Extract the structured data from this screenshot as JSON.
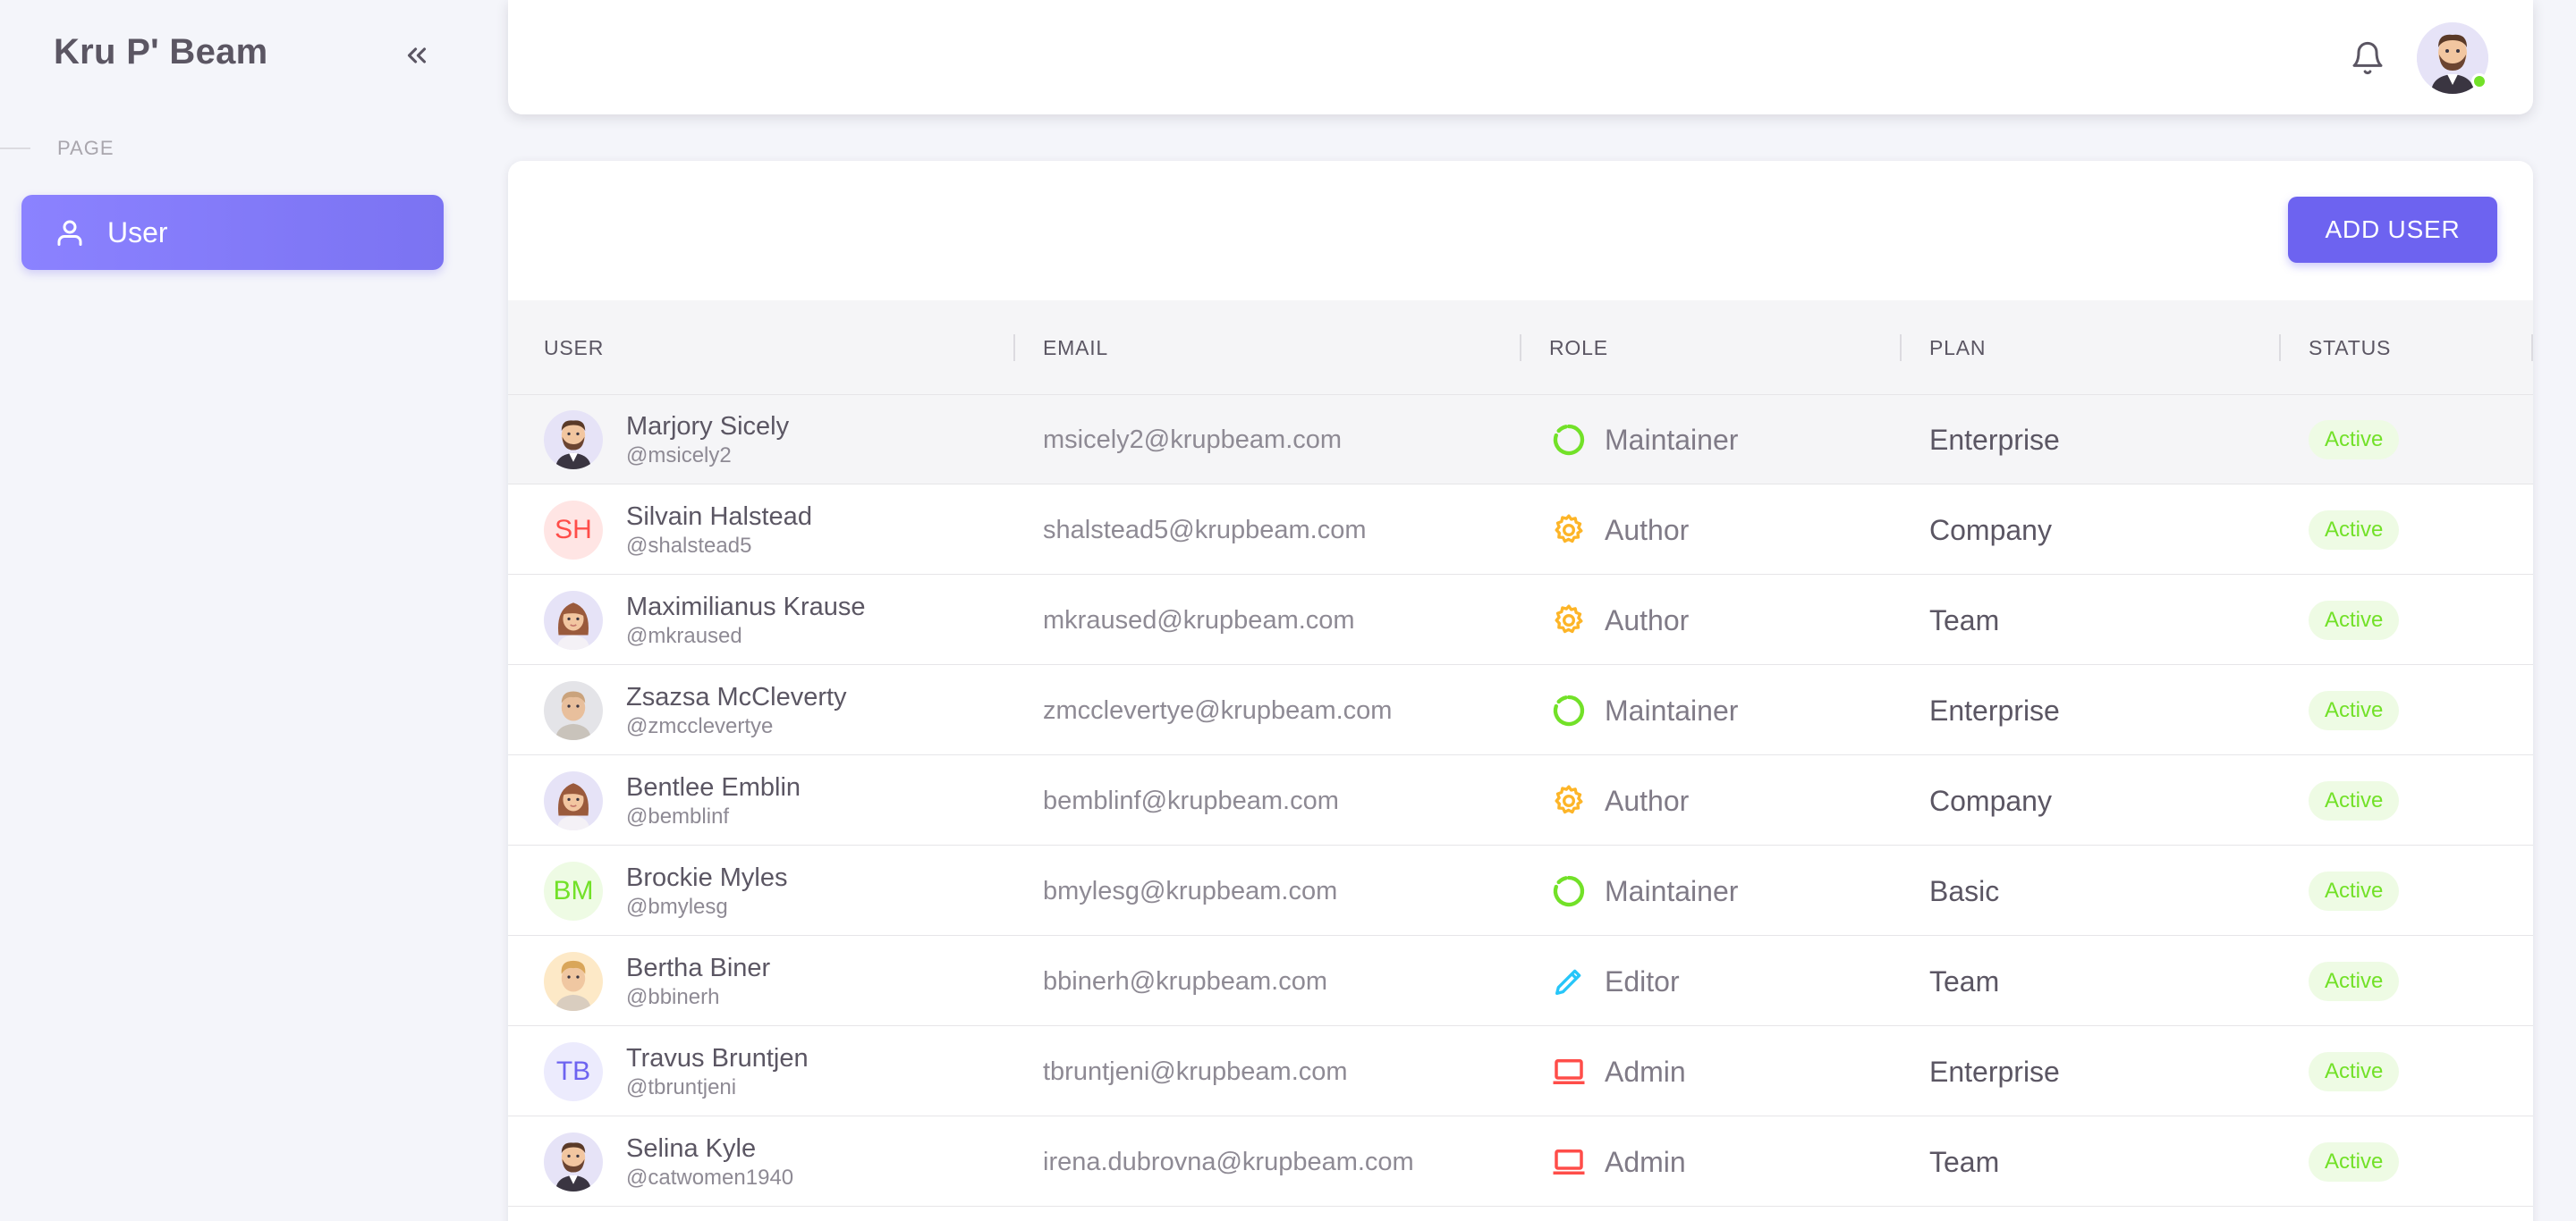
{
  "sidebar": {
    "brand": "Kru P' Beam",
    "collapse_icon": "chevron-double-left-icon",
    "section_label": "PAGE",
    "items": [
      {
        "label": "User",
        "icon": "person-icon",
        "active": true
      }
    ]
  },
  "header": {
    "notification_icon": "bell-icon",
    "avatar_icon": "user-avatar",
    "status": "online"
  },
  "main": {
    "add_button": "ADD USER",
    "columns": [
      "USER",
      "EMAIL",
      "ROLE",
      "PLAN",
      "STATUS"
    ],
    "rows": [
      {
        "name": "Marjory Sicely",
        "handle": "@msicely2",
        "avatar": "man-beard",
        "email": "msicely2@krupbeam.com",
        "role": "Maintainer",
        "role_icon": "maintainer-icon",
        "plan": "Enterprise",
        "status": "Active"
      },
      {
        "name": "Silvain Halstead",
        "handle": "@shalstead5",
        "avatar": "SH",
        "email": "shalstead5@krupbeam.com",
        "role": "Author",
        "role_icon": "cog-icon",
        "plan": "Company",
        "status": "Active"
      },
      {
        "name": "Maximilianus Krause",
        "handle": "@mkraused",
        "avatar": "woman",
        "email": "mkraused@krupbeam.com",
        "role": "Author",
        "role_icon": "cog-icon",
        "plan": "Team",
        "status": "Active"
      },
      {
        "name": "Zsazsa McCleverty",
        "handle": "@zmcclevertye",
        "avatar": "man-grey",
        "email": "zmcclevertye@krupbeam.com",
        "role": "Maintainer",
        "role_icon": "maintainer-icon",
        "plan": "Enterprise",
        "status": "Active"
      },
      {
        "name": "Bentlee Emblin",
        "handle": "@bemblinf",
        "avatar": "woman",
        "email": "bemblinf@krupbeam.com",
        "role": "Author",
        "role_icon": "cog-icon",
        "plan": "Company",
        "status": "Active"
      },
      {
        "name": "Brockie Myles",
        "handle": "@bmylesg",
        "avatar": "BM",
        "email": "bmylesg@krupbeam.com",
        "role": "Maintainer",
        "role_icon": "maintainer-icon",
        "plan": "Basic",
        "status": "Active"
      },
      {
        "name": "Bertha Biner",
        "handle": "@bbinerh",
        "avatar": "man-blond",
        "email": "bbinerh@krupbeam.com",
        "role": "Editor",
        "role_icon": "pencil-icon",
        "plan": "Team",
        "status": "Active"
      },
      {
        "name": "Travus Bruntjen",
        "handle": "@tbruntjeni",
        "avatar": "TB",
        "email": "tbruntjeni@krupbeam.com",
        "role": "Admin",
        "role_icon": "laptop-icon",
        "plan": "Enterprise",
        "status": "Active"
      },
      {
        "name": "Selina Kyle",
        "handle": "@catwomen1940",
        "avatar": "man-beard",
        "email": "irena.dubrovna@krupbeam.com",
        "role": "Admin",
        "role_icon": "laptop-icon",
        "plan": "Team",
        "status": "Active"
      }
    ]
  },
  "colors": {
    "primary": "#6d63f0",
    "success": "#72e128",
    "warning": "#fdb528",
    "info": "#26c6f9",
    "error": "#ff4d49"
  }
}
